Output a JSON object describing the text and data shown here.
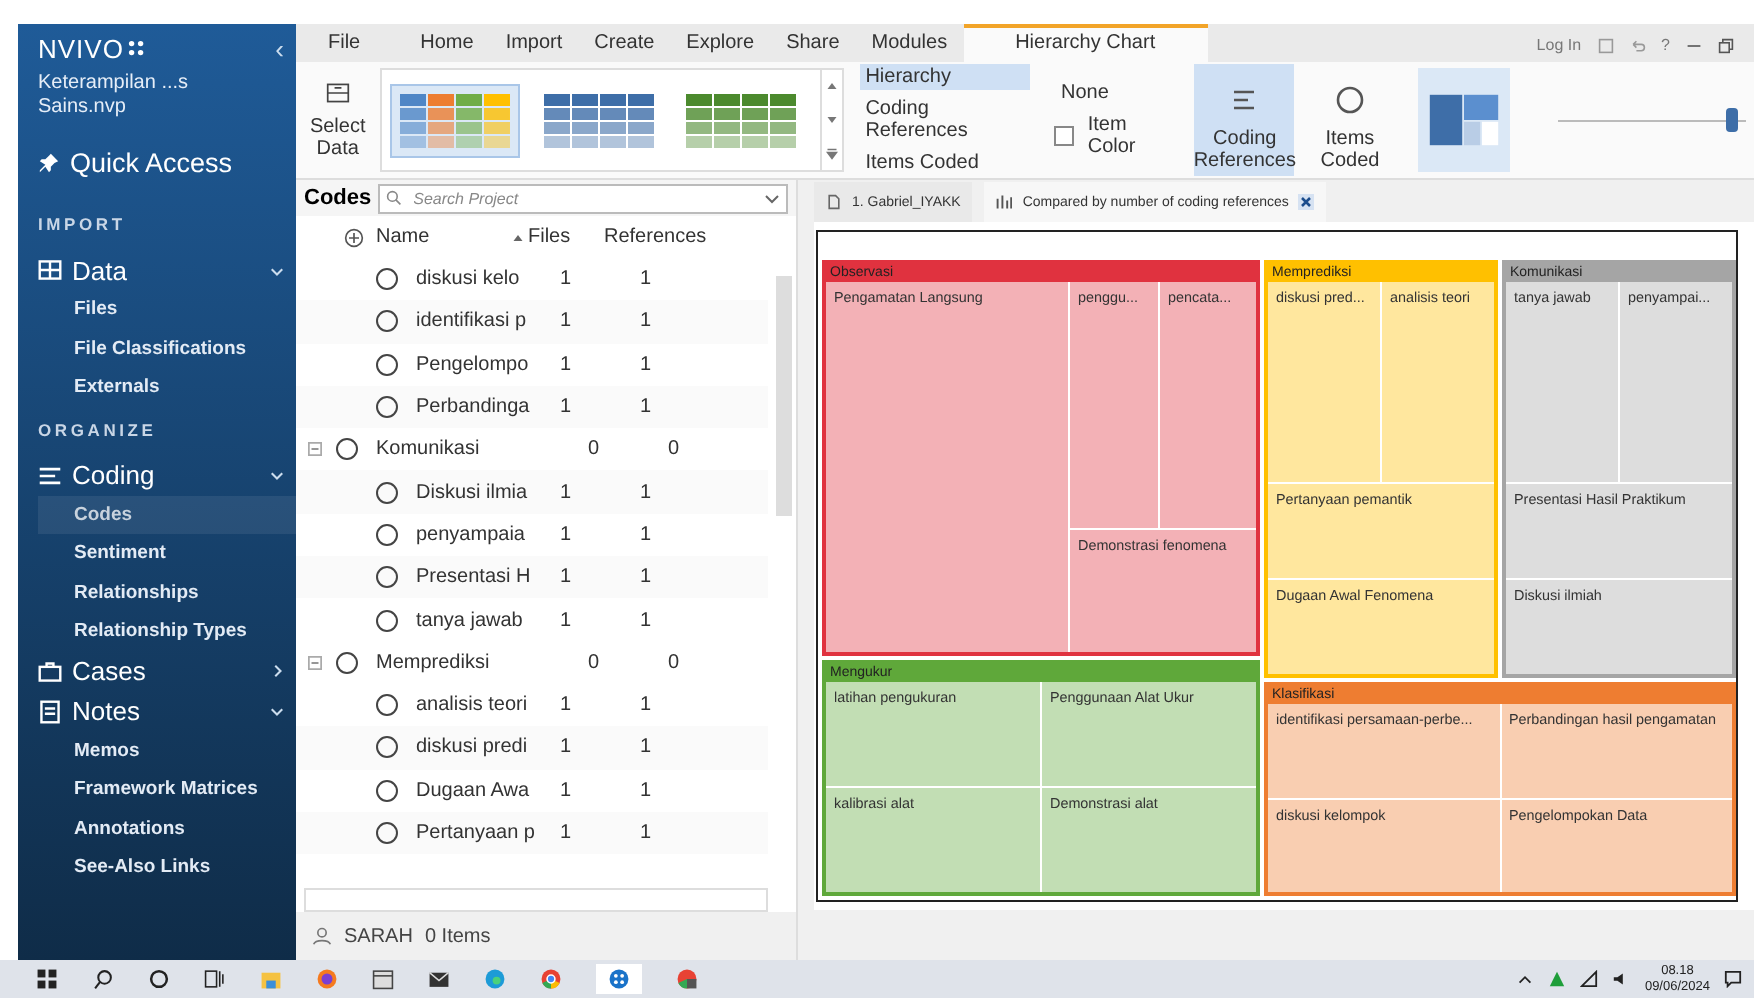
{
  "sidebar": {
    "logo": "NVIVO",
    "collapse": "‹",
    "project": "Keterampilan ...s Sains.nvp",
    "quick_access": "Quick Access",
    "sections": [
      {
        "heading": "IMPORT",
        "groups": [
          {
            "kind": "data",
            "label": "Data",
            "expanded": true,
            "items": [
              {
                "label": "Files",
                "selected": false
              },
              {
                "label": "File Classifications",
                "selected": false
              },
              {
                "label": "Externals",
                "selected": false
              }
            ]
          }
        ]
      },
      {
        "heading": "ORGANIZE",
        "groups": [
          {
            "kind": "coding",
            "label": "Coding",
            "expanded": true,
            "items": [
              {
                "label": "Codes",
                "selected": true
              },
              {
                "label": "Sentiment",
                "selected": false
              },
              {
                "label": "Relationships",
                "selected": false
              },
              {
                "label": "Relationship Types",
                "selected": false
              }
            ]
          },
          {
            "kind": "cases",
            "label": "Cases",
            "expanded": false
          },
          {
            "kind": "notes",
            "label": "Notes",
            "expanded": true,
            "items": [
              {
                "label": "Memos",
                "selected": false
              },
              {
                "label": "Framework Matrices",
                "selected": false
              },
              {
                "label": "Annotations",
                "selected": false
              },
              {
                "label": "See-Also Links",
                "selected": false
              }
            ]
          }
        ]
      }
    ]
  },
  "ribbon": {
    "tabs": [
      {
        "label": "File",
        "selected": false
      },
      {
        "label": "Home",
        "selected": false
      },
      {
        "label": "Import",
        "selected": false
      },
      {
        "label": "Create",
        "selected": false
      },
      {
        "label": "Explore",
        "selected": false
      },
      {
        "label": "Share",
        "selected": false
      },
      {
        "label": "Modules",
        "selected": false
      },
      {
        "label": "Hierarchy Chart",
        "selected": true
      }
    ],
    "account": "Log In",
    "help": "?",
    "select_data": "Select Data",
    "palettes": [
      {
        "kind": "multi",
        "selected": true
      },
      {
        "kind": "blue",
        "selected": false
      },
      {
        "kind": "green",
        "selected": false
      }
    ],
    "options": [
      {
        "label": "Hierarchy",
        "selected": true
      },
      {
        "label": "Coding References",
        "selected": false
      },
      {
        "label": "Items Coded",
        "selected": false
      }
    ],
    "none": "None",
    "item_color": {
      "label": "Item Color",
      "checked": false
    },
    "size_by": [
      {
        "kind": "references",
        "label": "Coding References",
        "selected": true
      },
      {
        "kind": "items",
        "label": "Items Coded",
        "selected": false
      }
    ],
    "zoom": {
      "level": 0.92
    }
  },
  "codes": {
    "title": "Codes",
    "placeholder": "Search Project",
    "columns": [
      "Name",
      "Files",
      "References"
    ],
    "rows": [
      {
        "children": [
          {
            "name": "diskusi kelo",
            "files": "1",
            "references": "1"
          },
          {
            "name": "identifikasi p",
            "files": "1",
            "references": "1"
          },
          {
            "name": "Pengelompo",
            "files": "1",
            "references": "1"
          },
          {
            "name": "Perbandinga",
            "files": "1",
            "references": "1"
          }
        ]
      },
      {
        "name": "Komunikasi",
        "files": "0",
        "references": "0",
        "children": [
          {
            "name": "Diskusi ilmia",
            "files": "1",
            "references": "1"
          },
          {
            "name": "penyampaia",
            "files": "1",
            "references": "1"
          },
          {
            "name": "Presentasi H",
            "files": "1",
            "references": "1"
          },
          {
            "name": "tanya jawab",
            "files": "1",
            "references": "1"
          }
        ]
      },
      {
        "name": "Memprediksi",
        "files": "0",
        "references": "0",
        "children": [
          {
            "name": "analisis teori",
            "files": "1",
            "references": "1"
          },
          {
            "name": "diskusi predi",
            "files": "1",
            "references": "1"
          },
          {
            "name": "Dugaan Awa",
            "files": "1",
            "references": "1"
          },
          {
            "name": "Pertanyaan p",
            "files": "1",
            "references": "1"
          }
        ]
      }
    ]
  },
  "status_bar": {
    "user": "SARAH",
    "items": "0 Items"
  },
  "doc_tabs": [
    {
      "kind": "file",
      "label": "1. Gabriel_IYAKK",
      "selected": false
    },
    {
      "kind": "chart",
      "label": "Compared by number of coding references",
      "selected": true
    }
  ],
  "treemap": {
    "groups": [
      {
        "name": "Observasi",
        "color": "#e0323f",
        "cells": [
          "Pengamatan Langsung",
          "penggu...",
          "pencata...",
          "Demonstrasi fenomena"
        ]
      },
      {
        "name": "Memprediksi",
        "color": "#ffc000",
        "cells": [
          "diskusi pred...",
          "analisis teori",
          "Pertanyaan pemantik",
          "Dugaan Awal Fenomena"
        ]
      },
      {
        "name": "Komunikasi",
        "color": "#a5a5a5",
        "cells": [
          "tanya jawab",
          "penyampai...",
          "Presentasi Hasil Praktikum",
          "Diskusi ilmiah"
        ]
      },
      {
        "name": "Mengukur",
        "color": "#5fa83a",
        "cells": [
          "latihan pengukuran",
          "Penggunaan Alat Ukur",
          "kalibrasi alat",
          "Demonstrasi alat"
        ]
      },
      {
        "name": "Klasifikasi",
        "color": "#ee7d31",
        "cells": [
          "identifikasi persamaan-perbe...",
          "Perbandingan hasil pengamatan",
          "diskusi kelompok",
          "Pengelompokan Data"
        ]
      }
    ]
  },
  "taskbar": {
    "time": "08.18",
    "date": "09/06/2024"
  }
}
